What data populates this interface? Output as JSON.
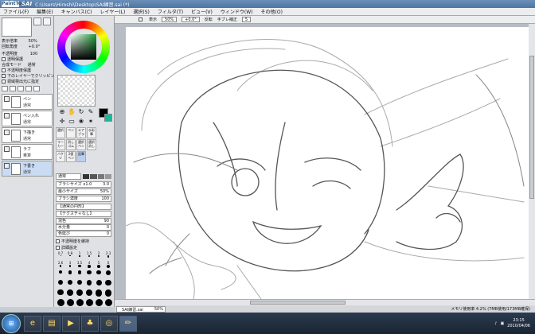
{
  "window": {
    "logo": "PaintTool",
    "app_label": "SAI",
    "title": "C:\\Users\\Hiroshi\\Desktop\\SAI練習.sai (*)"
  },
  "menu": [
    "ファイル(F)",
    "編集(E)",
    "キャンバス(C)",
    "レイヤー(L)",
    "選択(S)",
    "フィルタ(T)",
    "ビュー(V)",
    "ウィンドウ(W)",
    "その他(O)"
  ],
  "left": {
    "zoom_label": "表示倍率",
    "zoom_value": "50%",
    "angle_label": "回転角度",
    "angle_value": "+0.0°",
    "opacity_label": "不透明度",
    "opacity_value": "100",
    "protect_label": "透明保護",
    "mode_label": "合成モード",
    "mode_value": "通常",
    "checks": [
      "不透明度保護",
      "下のレイヤーでクリッピング",
      "領域検出元に指定"
    ],
    "layers": [
      {
        "name": "ペン",
        "mode": "通常"
      },
      {
        "name": "ペン入れ",
        "mode": "通常"
      },
      {
        "name": "下描き",
        "mode": "通常"
      },
      {
        "name": "ラフ",
        "mode": "乗算"
      },
      {
        "name": "下書き",
        "mode": "通常"
      }
    ]
  },
  "mid": {
    "tools": [
      [
        "選択",
        "ペン",
        "エアブラシ",
        "水彩筆"
      ],
      [
        "マーカー",
        "消しゴム",
        "選択ペン",
        "選択消し"
      ],
      [
        "バケツ",
        "2値ペン",
        "鉛筆",
        ""
      ]
    ],
    "selected_tool": "鉛筆",
    "mode_value": "通常",
    "brush_size_label": "ブラシサイズ",
    "brush_size_mult": "x1.0",
    "brush_size": "3.0",
    "min_size_label": "最小サイズ",
    "min_size": "50%",
    "density_label": "ブラシ濃度",
    "density": "100",
    "shape_label": "【通常の円形】",
    "shape_value": "50",
    "texture_label": "【テクスチャなし】",
    "texture_value": "95",
    "blend_label": "混色",
    "blend": "90",
    "water_label": "水分量",
    "water": "0",
    "persist_label": "色延び",
    "persist": "0",
    "checkbox_label": "不透明度を維持",
    "detail_label": "詳細設定",
    "sizes": [
      "0.7",
      "0.8",
      "1",
      "1.5",
      "2",
      "2.3",
      "2.6",
      "3",
      "3.5",
      "4",
      "5",
      "6",
      "7",
      "8",
      "9",
      "10",
      "12",
      "14",
      "16",
      "20",
      "25",
      "30",
      "35",
      "40",
      "50",
      "60",
      "70",
      "80",
      "100",
      "120",
      "150",
      "200",
      "250",
      "300",
      "350",
      "400"
    ]
  },
  "canvas_bar": {
    "view_label": "表示",
    "zoom": "50%",
    "angle": "+0.0°",
    "antialias_label": "手ブレ補正",
    "antialias_value": "5",
    "reverse_label": "反転"
  },
  "doc": {
    "tab_name": "SAI練習.sai",
    "tab_zoom": "50%",
    "status": "メモリ使用率 4.2% (7MB使用/173MB確保)"
  },
  "taskbar": {
    "time": "23:15",
    "date": "2010/04/06"
  }
}
